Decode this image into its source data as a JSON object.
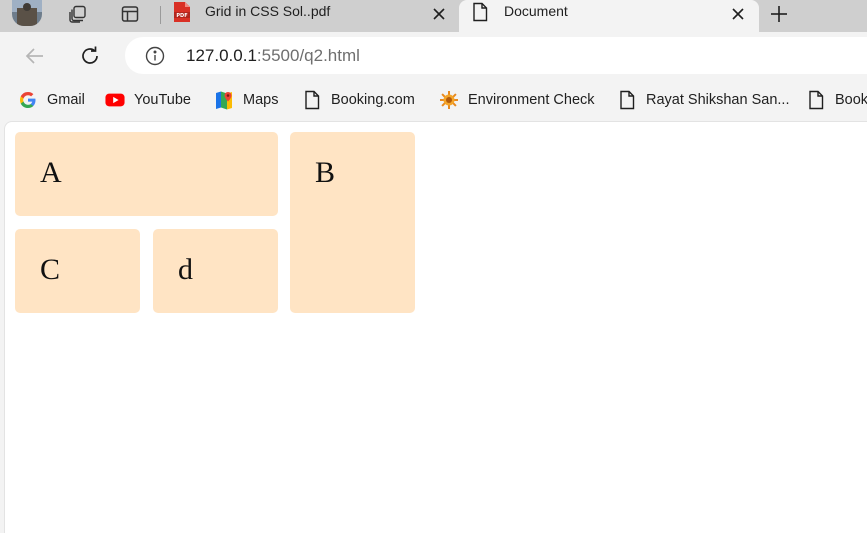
{
  "tabs": [
    {
      "title": "Grid in CSS Sol..pdf",
      "icon": "pdf-icon",
      "active": false
    },
    {
      "title": "Document",
      "icon": "document-icon",
      "active": true
    }
  ],
  "toolbar": {
    "url_host": "127.0.0.1",
    "url_rest": ":5500/q2.html"
  },
  "bookmarks": [
    {
      "label": "Gmail",
      "icon": "google-icon"
    },
    {
      "label": "YouTube",
      "icon": "youtube-icon"
    },
    {
      "label": "Maps",
      "icon": "maps-icon"
    },
    {
      "label": "Booking.com",
      "icon": "page-icon"
    },
    {
      "label": "Environment Check",
      "icon": "environment-check-icon"
    },
    {
      "label": "Rayat Shikshan San...",
      "icon": "page-icon"
    },
    {
      "label": "Book",
      "icon": "page-icon"
    }
  ],
  "page": {
    "items": [
      "A",
      "B",
      "C",
      "d"
    ]
  },
  "colors": {
    "grid_item_bg": "#ffe4c4",
    "tabstrip_bg": "#cfcfcf",
    "toolbar_bg": "#f3f3f3"
  }
}
